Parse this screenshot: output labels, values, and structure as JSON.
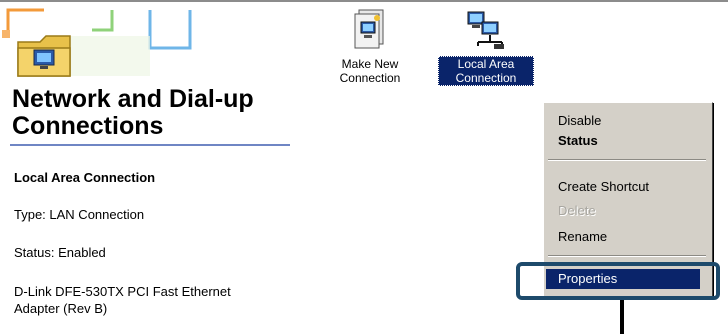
{
  "window": {
    "title": "Network and Dial-up Connections"
  },
  "details": {
    "name": "Local Area Connection",
    "type": "Type: LAN Connection",
    "status": "Status: Enabled",
    "adapter": "D-Link DFE-530TX PCI Fast Ethernet Adapter (Rev B)"
  },
  "icons": [
    {
      "label": "Make New Connection",
      "icon": "make-new-connection-icon",
      "selected": false
    },
    {
      "label": "Local Area Connection",
      "icon": "local-area-connection-icon",
      "selected": true
    }
  ],
  "context_menu": {
    "items": [
      {
        "label": "Disable",
        "style": "normal"
      },
      {
        "label": "Status",
        "style": "bold"
      },
      {
        "label": "Create Shortcut",
        "style": "normal"
      },
      {
        "label": "Delete",
        "style": "disabled"
      },
      {
        "label": "Rename",
        "style": "normal"
      },
      {
        "label": "Properties",
        "style": "highlighted"
      }
    ]
  },
  "colors": {
    "selection": "#0a246a",
    "menu_background": "#d4d0c8",
    "callout_border": "#1d4a6b",
    "title_rule": "#6f86c4"
  }
}
